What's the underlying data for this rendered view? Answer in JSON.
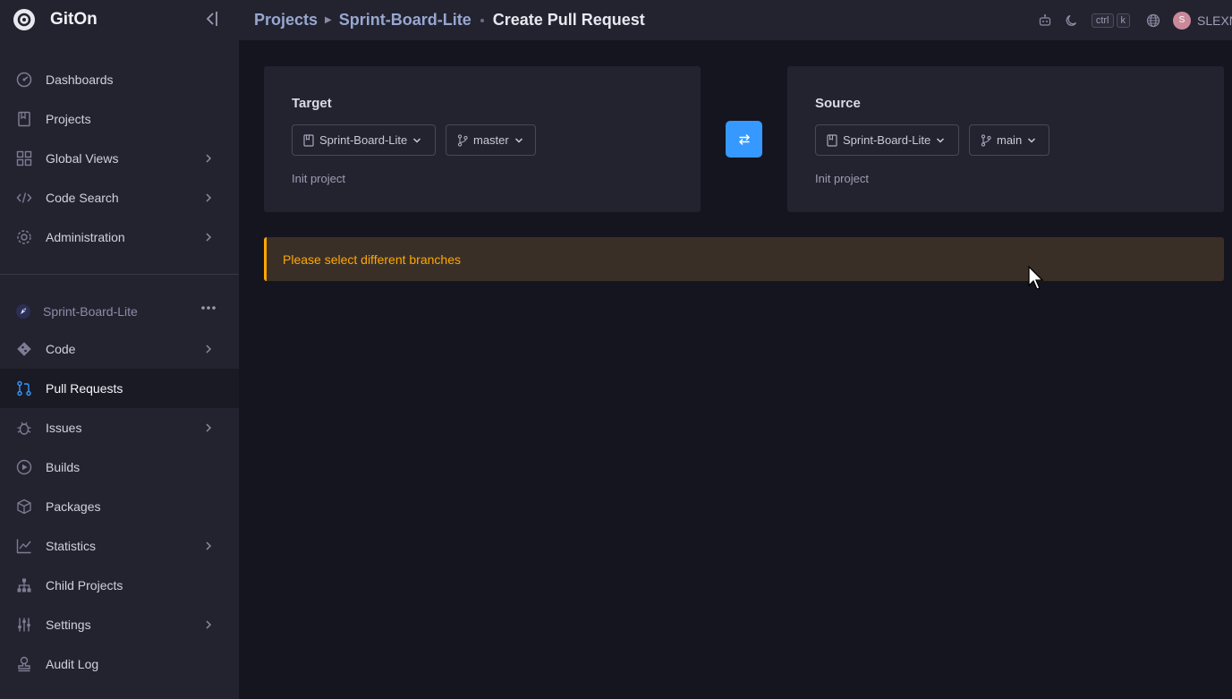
{
  "brand": {
    "name": "GitOn"
  },
  "nav": [
    {
      "label": "Dashboards",
      "icon": "dashboard-icon",
      "chevron": false
    },
    {
      "label": "Projects",
      "icon": "book-icon",
      "chevron": false
    },
    {
      "label": "Global Views",
      "icon": "grid-icon",
      "chevron": true
    },
    {
      "label": "Code Search",
      "icon": "code-icon",
      "chevron": true
    },
    {
      "label": "Administration",
      "icon": "gear-icon",
      "chevron": true
    }
  ],
  "project": {
    "name": "Sprint-Board-Lite",
    "items": [
      {
        "label": "Code",
        "icon": "git-icon",
        "chevron": true,
        "active": false
      },
      {
        "label": "Pull Requests",
        "icon": "pull-request-icon",
        "chevron": false,
        "active": true
      },
      {
        "label": "Issues",
        "icon": "bug-icon",
        "chevron": true,
        "active": false
      },
      {
        "label": "Builds",
        "icon": "play-circle-icon",
        "chevron": false,
        "active": false
      },
      {
        "label": "Packages",
        "icon": "package-icon",
        "chevron": false,
        "active": false
      },
      {
        "label": "Statistics",
        "icon": "chart-icon",
        "chevron": true,
        "active": false
      },
      {
        "label": "Child Projects",
        "icon": "hierarchy-icon",
        "chevron": false,
        "active": false
      },
      {
        "label": "Settings",
        "icon": "sliders-icon",
        "chevron": true,
        "active": false
      },
      {
        "label": "Audit Log",
        "icon": "stamp-icon",
        "chevron": false,
        "active": false
      }
    ]
  },
  "breadcrumb": {
    "projects": "Projects",
    "project": "Sprint-Board-Lite",
    "current": "Create Pull Request"
  },
  "topbar": {
    "kbd_ctrl": "ctrl",
    "kbd_k": "k",
    "avatar_initial": "S",
    "username": "SLEXN"
  },
  "target": {
    "title": "Target",
    "project": "Sprint-Board-Lite",
    "branch": "master",
    "commit": "Init project"
  },
  "source": {
    "title": "Source",
    "project": "Sprint-Board-Lite",
    "branch": "main",
    "commit": "Init project"
  },
  "alert": {
    "message": "Please select different branches"
  },
  "colors": {
    "accent": "#3699ff",
    "warning": "#ffa800",
    "warning_bg": "#3a2f27",
    "sidebar_bg": "#232330",
    "page_bg": "#15151f"
  }
}
